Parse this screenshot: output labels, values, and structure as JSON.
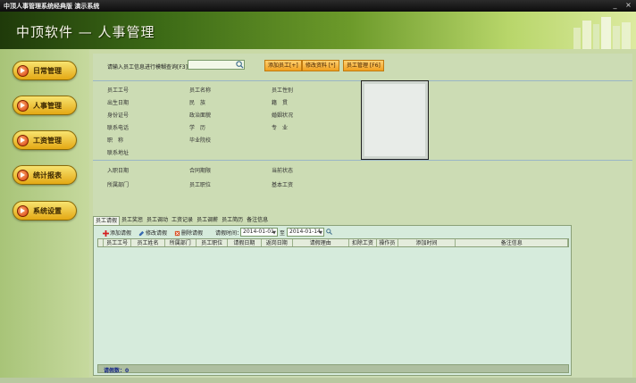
{
  "window": {
    "title": "中顶人事管理系统经典版  演示系统",
    "controls": [
      "_",
      "×"
    ]
  },
  "banner": {
    "brand": "中顶软件 — 人事管理"
  },
  "sidebar": {
    "items": [
      {
        "label": "日常管理"
      },
      {
        "label": "人事管理"
      },
      {
        "label": "工资管理"
      },
      {
        "label": "统计报表"
      },
      {
        "label": "系统设置"
      }
    ]
  },
  "search": {
    "prompt": "请输入员工信息进行模糊查询[F3]",
    "value": "",
    "placeholder": ""
  },
  "toolbar": {
    "add_label": "添加员工[+]",
    "edit_label": "修改资料 [*]",
    "manage_label": "员工管理 [F6]"
  },
  "detail_fields": {
    "col1": [
      "员工工号",
      "出生日期",
      "身份证号",
      "联系电话",
      "职　称",
      "联系地址"
    ],
    "col2": [
      "员工名称",
      "民　族",
      "政治面貌",
      "学　历",
      "毕业院校"
    ],
    "col3": [
      "员工性别",
      "籍　贯",
      "婚姻状况",
      "专　业"
    ],
    "lower1": [
      "入职日期",
      "所属部门"
    ],
    "lower2": [
      "合同期限",
      "员工职位"
    ],
    "lower3": [
      "当前状态",
      "基本工资"
    ]
  },
  "tabs": [
    "员工请假",
    "员工奖惩",
    "员工调动",
    "工资记录",
    "员工调薪",
    "员工简历",
    "备注信息"
  ],
  "panel": {
    "add_leave": "添加请假",
    "edit_leave": "修改请假",
    "delete_leave": "删除请假",
    "time_label": "请假时间：",
    "date_from": "2014-01-01",
    "date_to": "2014-01-14",
    "to_label": "至"
  },
  "grid": {
    "columns": [
      "员工工号",
      "员工姓名",
      "所属部门",
      "员工职位",
      "请假日期",
      "返岗日期",
      "请假理由",
      "扣除工资",
      "操作员",
      "添加时间",
      "备注信息"
    ]
  },
  "status": {
    "count_text": "请假数：0"
  },
  "colors": {
    "accent": "#e4a814",
    "banner_dark": "#1f3a0a",
    "panel_bg": "#d6ebdc"
  }
}
